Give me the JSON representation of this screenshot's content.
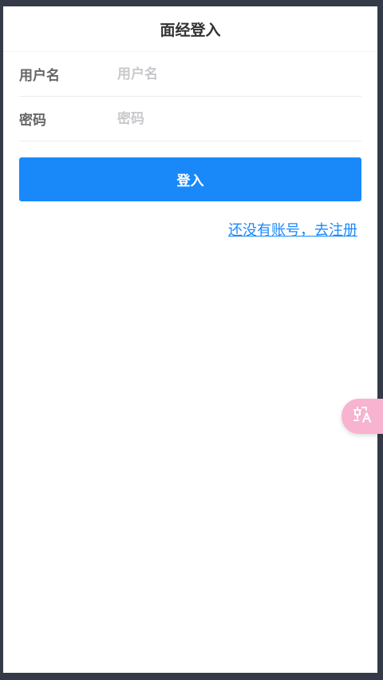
{
  "navbar": {
    "title": "面经登入"
  },
  "form": {
    "username": {
      "label": "用户名",
      "placeholder": "用户名",
      "value": ""
    },
    "password": {
      "label": "密码",
      "placeholder": "密码",
      "value": ""
    }
  },
  "actions": {
    "login_label": "登入",
    "register_link": "还没有账号，去注册"
  },
  "floating": {
    "icon": "translate-icon"
  },
  "colors": {
    "primary": "#1989fa",
    "fab": "#f7b3cf",
    "frame": "#353a48"
  }
}
